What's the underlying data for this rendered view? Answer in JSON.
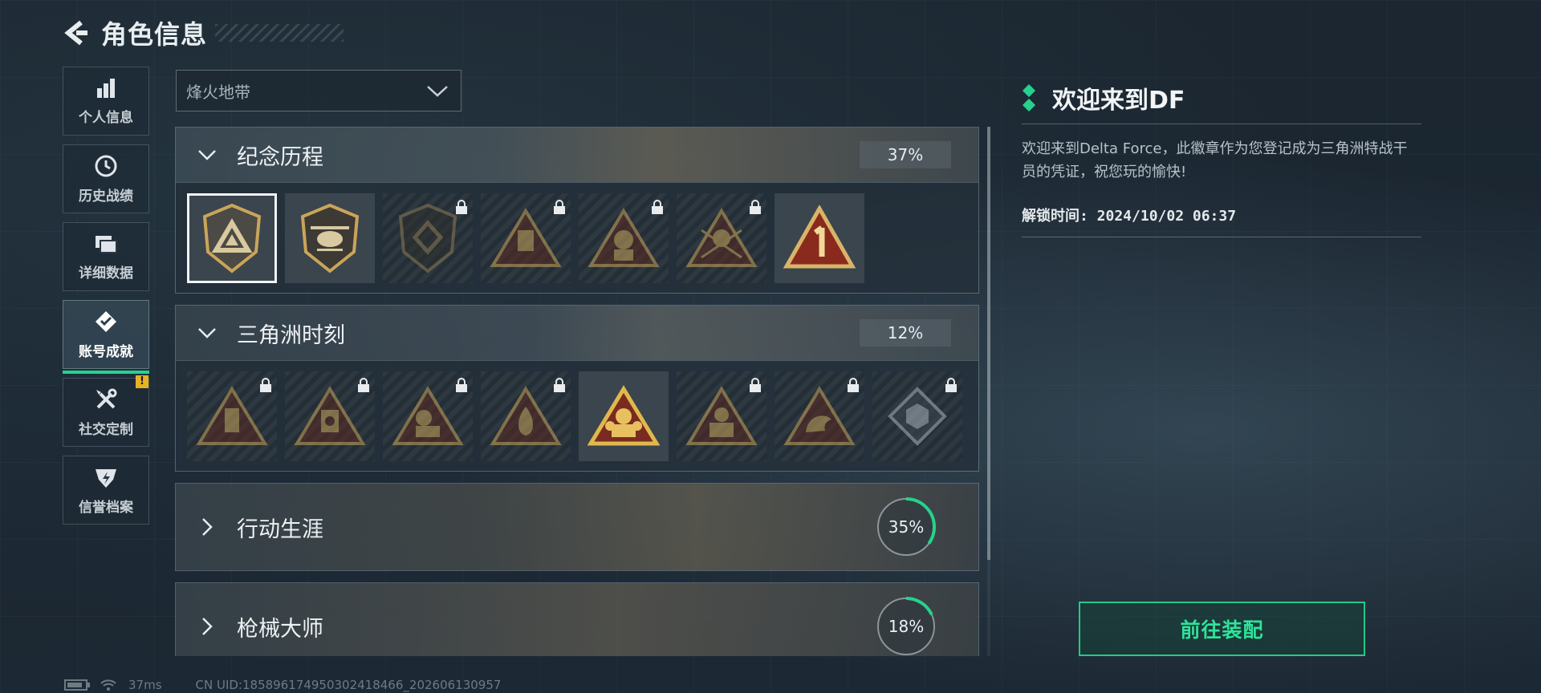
{
  "header": {
    "title": "角色信息"
  },
  "sidebar": {
    "items": [
      {
        "label": "个人信息",
        "icon": "bar-chart-icon"
      },
      {
        "label": "历史战绩",
        "icon": "clock-icon"
      },
      {
        "label": "详细数据",
        "icon": "folders-icon"
      },
      {
        "label": "账号成就",
        "icon": "achievement-icon",
        "active": true
      },
      {
        "label": "社交定制",
        "icon": "tools-icon",
        "badge": "!"
      },
      {
        "label": "信誉档案",
        "icon": "shield-icon"
      }
    ]
  },
  "filter": {
    "selected": "烽火地带"
  },
  "categories": [
    {
      "name": "纪念历程",
      "progress": "37%",
      "expanded": true,
      "badges": [
        {
          "icon": "triangle-emblem-icon",
          "locked": false,
          "selected": true
        },
        {
          "icon": "helicopter-emblem-icon",
          "locked": false
        },
        {
          "icon": "diamond-emblem-icon",
          "locked": true
        },
        {
          "icon": "robot-emblem-icon",
          "locked": true
        },
        {
          "icon": "portrait-emblem-icon",
          "locked": true
        },
        {
          "icon": "soldier-emblem-icon",
          "locked": true
        },
        {
          "icon": "number-one-emblem-icon",
          "locked": false
        }
      ]
    },
    {
      "name": "三角洲时刻",
      "progress": "12%",
      "expanded": true,
      "badges": [
        {
          "icon": "usb-emblem-icon",
          "locked": true
        },
        {
          "icon": "skull-emblem-icon",
          "locked": true
        },
        {
          "icon": "medic-emblem-icon",
          "locked": true
        },
        {
          "icon": "flame-emblem-icon",
          "locked": true
        },
        {
          "icon": "squad-emblem-icon",
          "locked": false
        },
        {
          "icon": "hero-emblem-icon",
          "locked": true
        },
        {
          "icon": "dragon-emblem-icon",
          "locked": true
        },
        {
          "icon": "cube-emblem-icon",
          "locked": true
        }
      ]
    },
    {
      "name": "行动生涯",
      "progress": "35%",
      "progress_value": 0.35,
      "expanded": false
    },
    {
      "name": "枪械大师",
      "progress": "18%",
      "progress_value": 0.18,
      "expanded": false
    }
  ],
  "detail": {
    "title": "欢迎来到DF",
    "description": "欢迎来到Delta Force，此徽章作为您登记成为三角洲特战干员的凭证，祝您玩的愉快!",
    "unlock_time": "解锁时间: 2024/10/02 06:37"
  },
  "goto_button": "前往装配",
  "footer": {
    "ping": "37ms",
    "uid": "CN UID:18589617495030241846​6_202606130957"
  },
  "colors": {
    "accent": "#27d18d",
    "badge_gold": "#c9a55a",
    "badge_red": "#6e2a22"
  }
}
